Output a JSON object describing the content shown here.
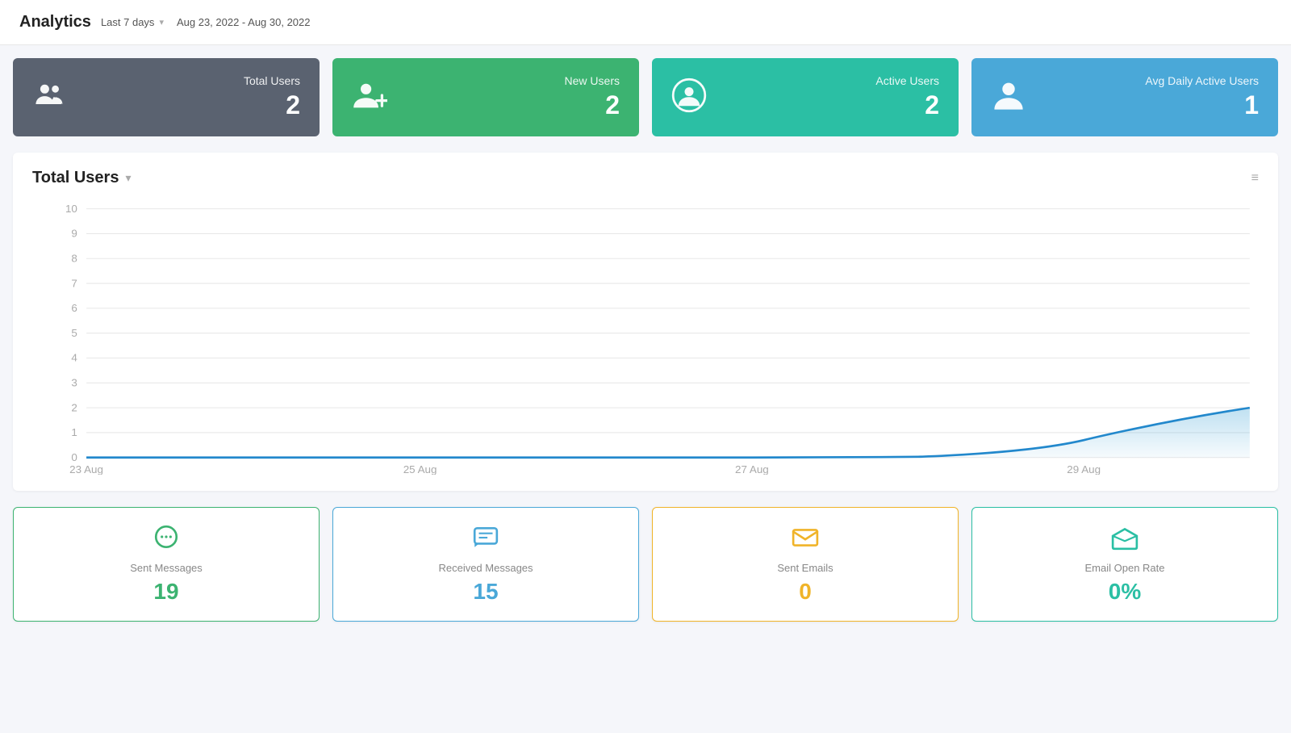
{
  "header": {
    "title": "Analytics",
    "filter_label": "Last 7 days",
    "date_range": "Aug 23, 2022 - Aug 30, 2022"
  },
  "metric_cards": [
    {
      "id": "total-users",
      "label": "Total Users",
      "value": "2",
      "color_class": "dark-gray",
      "icon": "group"
    },
    {
      "id": "new-users",
      "label": "New Users",
      "value": "2",
      "color_class": "green",
      "icon": "person-add"
    },
    {
      "id": "active-users",
      "label": "Active Users",
      "value": "2",
      "color_class": "teal",
      "icon": "person-circle"
    },
    {
      "id": "avg-daily-active",
      "label": "Avg Daily Active Users",
      "value": "1",
      "color_class": "blue",
      "icon": "person"
    }
  ],
  "chart": {
    "title": "Total Users",
    "y_axis": [
      10,
      9,
      8,
      7,
      6,
      5,
      4,
      3,
      2,
      1,
      0
    ],
    "x_axis": [
      "23 Aug",
      "25 Aug",
      "27 Aug",
      "29 Aug"
    ],
    "menu_icon": "≡"
  },
  "bottom_cards": [
    {
      "id": "sent-messages",
      "label": "Sent Messages",
      "value": "19",
      "color": "green",
      "border_class": "green-border",
      "icon": "chat"
    },
    {
      "id": "received-messages",
      "label": "Received Messages",
      "value": "15",
      "color": "blue",
      "border_class": "blue-border",
      "icon": "message"
    },
    {
      "id": "sent-emails",
      "label": "Sent Emails",
      "value": "0",
      "color": "yellow",
      "border_class": "yellow-border",
      "icon": "mail"
    },
    {
      "id": "email-open-rate",
      "label": "Email Open Rate",
      "value": "0%",
      "color": "teal",
      "border_class": "teal-border",
      "icon": "mail-open"
    }
  ]
}
